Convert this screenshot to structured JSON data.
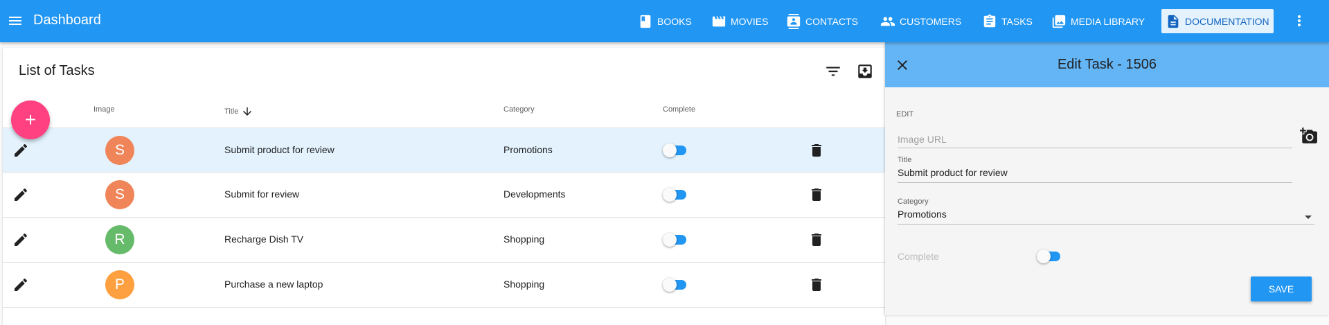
{
  "app": {
    "title": "Dashboard"
  },
  "nav": {
    "items": [
      {
        "label": "BOOKS",
        "icon": "book-icon"
      },
      {
        "label": "MOVIES",
        "icon": "movie-icon"
      },
      {
        "label": "CONTACTS",
        "icon": "contacts-icon"
      },
      {
        "label": "CUSTOMERS",
        "icon": "people-icon"
      },
      {
        "label": "TASKS",
        "icon": "assignment-icon"
      },
      {
        "label": "MEDIA LIBRARY",
        "icon": "photo-library-icon"
      },
      {
        "label": "DOCUMENTATION",
        "icon": "description-icon",
        "active": true
      }
    ]
  },
  "list": {
    "title": "List of Tasks",
    "columns": {
      "image": "Image",
      "title": "Title",
      "category": "Category",
      "complete": "Complete"
    },
    "sort": {
      "column": "title",
      "direction": "descending"
    },
    "rows": [
      {
        "initial": "S",
        "avatar_color": "#f0855a",
        "title": "Submit product for review",
        "category": "Promotions",
        "complete": true,
        "selected": true
      },
      {
        "initial": "S",
        "avatar_color": "#f0855a",
        "title": "Submit for review",
        "category": "Developments",
        "complete": true,
        "selected": false
      },
      {
        "initial": "R",
        "avatar_color": "#66bb6a",
        "title": "Recharge Dish TV",
        "category": "Shopping",
        "complete": true,
        "selected": false
      },
      {
        "initial": "P",
        "avatar_color": "#ffa040",
        "title": "Purchase a new laptop",
        "category": "Shopping",
        "complete": true,
        "selected": false
      }
    ]
  },
  "edit": {
    "title": "Edit Task - 1506",
    "section": "EDIT",
    "image_url_placeholder": "Image URL",
    "title_label": "Title",
    "title_value": "Submit product for review",
    "category_label": "Category",
    "category_value": "Promotions",
    "complete_label": "Complete",
    "complete": true,
    "save_label": "SAVE"
  },
  "colors": {
    "primary": "#2196f3",
    "accent": "#ff4081",
    "panel_header": "#64b5f6",
    "selected_row": "#e3f2fd"
  }
}
